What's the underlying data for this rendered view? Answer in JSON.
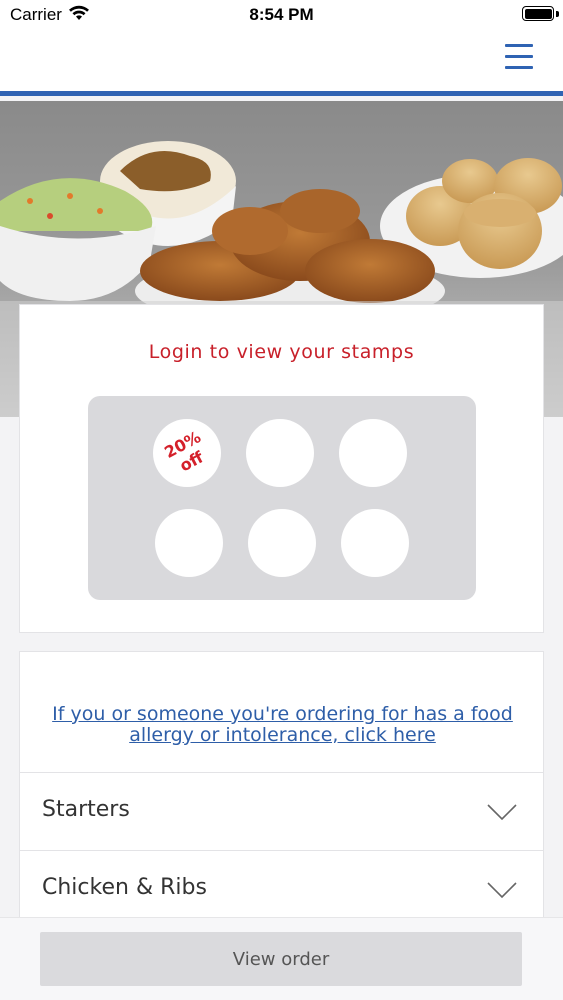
{
  "status_bar": {
    "carrier": "Carrier",
    "time": "8:54 PM"
  },
  "header": {
    "menu_icon": "hamburger-menu-icon",
    "accent_color": "#2f63b3"
  },
  "hero": {
    "description_icon": "food-photo"
  },
  "stamp_card": {
    "title": "Login to view your stamps",
    "title_color": "#c8202a",
    "stamps": [
      {
        "label": "20%\noff"
      },
      {
        "label": ""
      },
      {
        "label": ""
      },
      {
        "label": ""
      },
      {
        "label": ""
      },
      {
        "label": ""
      }
    ]
  },
  "menu": {
    "allergy_link": "If you or someone you're ordering for has a food allergy or intolerance, click here",
    "categories": [
      {
        "label": "Starters",
        "icon": "chevron-down-icon"
      },
      {
        "label": "Chicken & Ribs",
        "icon": "chevron-down-icon"
      }
    ]
  },
  "footer": {
    "view_order_label": "View order"
  }
}
